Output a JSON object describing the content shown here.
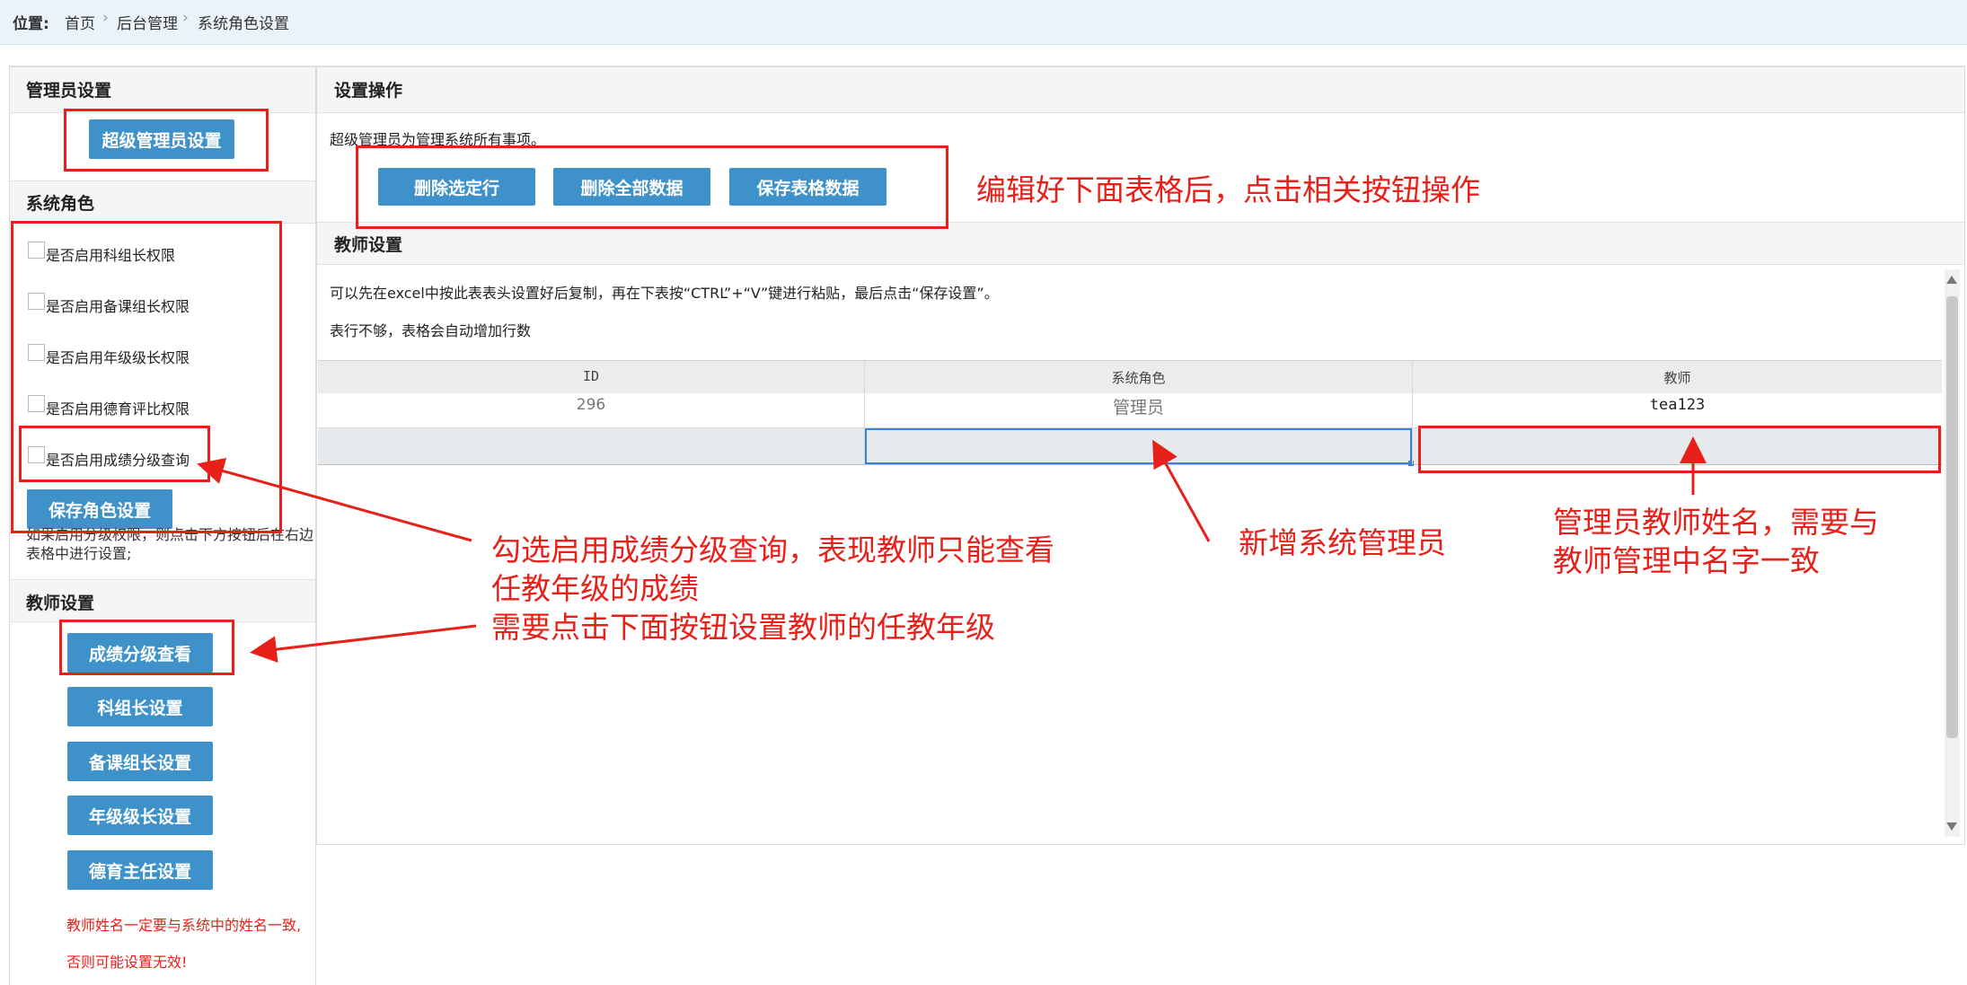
{
  "breadcrumb": {
    "label": "位置:",
    "items": [
      "首页",
      "后台管理",
      "系统角色设置"
    ],
    "separator": "›"
  },
  "admin_section": {
    "title": "管理员设置",
    "super_admin_button": "超级管理员设置"
  },
  "roles_section": {
    "title": "系统角色",
    "checkboxes": [
      {
        "label": "是否启用科组长权限",
        "checked": false
      },
      {
        "label": "是否启用备课组长权限",
        "checked": false
      },
      {
        "label": "是否启用年级级长权限",
        "checked": false
      },
      {
        "label": "是否启用德育评比权限",
        "checked": false
      },
      {
        "label": "是否启用成绩分级查询",
        "checked": false
      }
    ],
    "save_button": "保存角色设置",
    "hint": "如果启用分级权限，则点击下方按钮后在右边表格中进行设置;"
  },
  "teacher_section": {
    "title": "教师设置",
    "buttons": [
      "成绩分级查看",
      "科组长设置",
      "备课组长设置",
      "年级级长设置",
      "德育主任设置"
    ],
    "warning_line1": "教师姓名一定要与系统中的姓名一致,",
    "warning_line2": "否则可能设置无效!"
  },
  "operations": {
    "title": "设置操作",
    "description": "超级管理员为管理系统所有事项。",
    "buttons": [
      "删除选定行",
      "删除全部数据",
      "保存表格数据"
    ]
  },
  "teacher_settings": {
    "title": "教师设置",
    "instruction": "可以先在excel中按此表表头设置好后复制，再在下表按“CTRL”+“V”键进行粘贴，最后点击“保存设置”。",
    "instruction2": "表行不够，表格会自动增加行数"
  },
  "table": {
    "columns": [
      "ID",
      "系统角色",
      "教师"
    ],
    "rows": [
      {
        "id": "296",
        "role": "管理员",
        "teacher": "tea123"
      },
      {
        "id": "",
        "role": "",
        "teacher": ""
      }
    ]
  },
  "annotations": {
    "ops_hint": "编辑好下面表格后，点击相关按钮操作",
    "grade_hint_line1": "勾选启用成绩分级查询，表现教师只能查看",
    "grade_hint_line2": "任教年级的成绩",
    "grade_hint_line3": "需要点击下面按钮设置教师的任教年级",
    "new_admin": "新增系统管理员",
    "teacher_name_line1": "管理员教师姓名，需要与",
    "teacher_name_line2": "教师管理中名字一致"
  },
  "colors": {
    "button_blue": "#3f92c9",
    "annotation_red": "#e8201a",
    "topbar_bg": "#eaf3fa"
  }
}
